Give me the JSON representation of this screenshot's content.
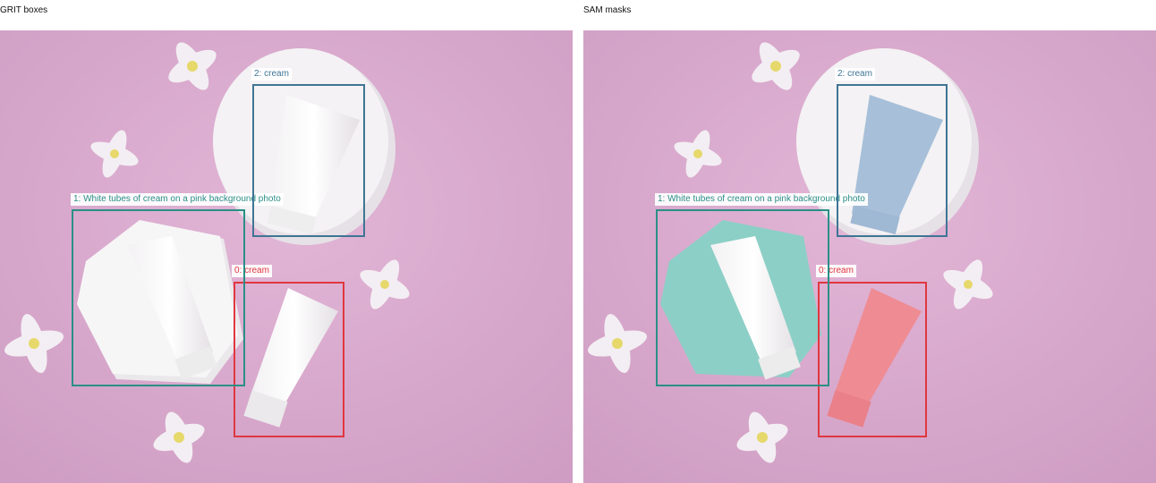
{
  "panels": [
    {
      "title": "GRIT boxes"
    },
    {
      "title": "SAM masks"
    }
  ],
  "detections": [
    {
      "label": "0: cream",
      "color": "#e0373f"
    },
    {
      "label": "1: White tubes of cream on a pink background photo",
      "color": "#2a8f87"
    },
    {
      "label": "2: cream",
      "color": "#3f7594"
    }
  ],
  "mask_colors": {
    "0": "#ef8b93",
    "1": "#8ccfc6",
    "2": "#a7bfd9"
  },
  "background_color": "#d7a7cb"
}
